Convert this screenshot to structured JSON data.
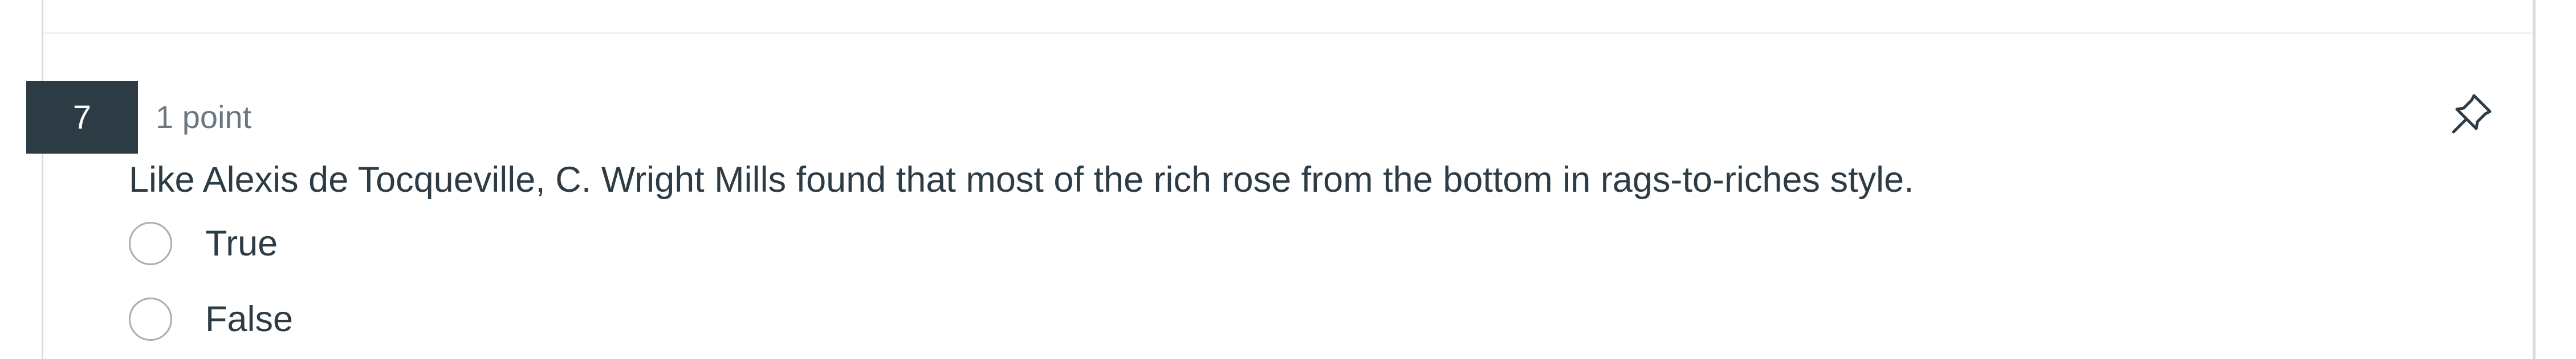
{
  "question": {
    "number": "7",
    "points": "1 point",
    "text": "Like Alexis de Tocqueville, C. Wright Mills found that most of the rich rose from the bottom in rags-to-riches style.",
    "pin_icon": "pushpin-icon",
    "answers": [
      {
        "label": "True",
        "selected": false
      },
      {
        "label": "False",
        "selected": false
      }
    ]
  },
  "colors": {
    "badge_background": "#2d3b45",
    "text": "#2d3b45",
    "muted_text": "#6b7780",
    "border": "#d7dadf",
    "radio_border": "#a5afb5"
  }
}
